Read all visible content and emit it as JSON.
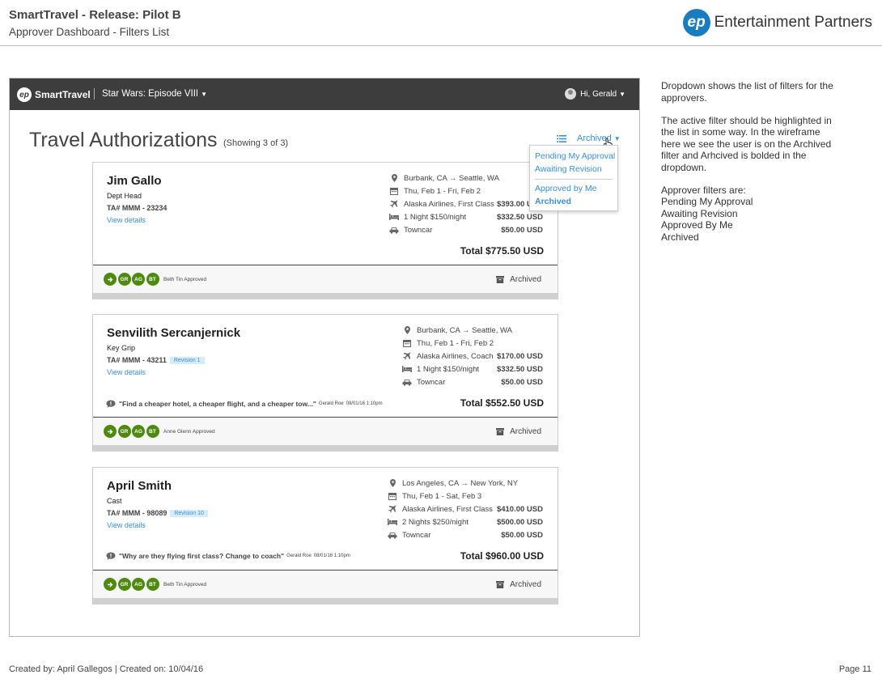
{
  "doc": {
    "title": "SmartTravel - Release: Pilot B",
    "subtitle": "Approver Dashboard - Filters List",
    "logo_mark": "ep",
    "logo_name": "Entertainment Partners",
    "footer_left": "Created by: April Gallegos | Created on: 10/04/16",
    "footer_right": "Page 11"
  },
  "app": {
    "logo_mark": "ep",
    "logo_name": "SmartTravel",
    "project": "Star Wars: Episode VIII",
    "user_greeting": "Hi, Gerald",
    "dark_color": "#3d3d3d",
    "link_color": "#3a8fd6"
  },
  "main": {
    "title": "Travel Authorizations",
    "showing": "(Showing 3 of 3)",
    "filter_label": "Archived",
    "filter_icon": "list-icon"
  },
  "dropdown": {
    "items": [
      {
        "label": "Pending My Approval",
        "active": false
      },
      {
        "label": "Awaiting Revision",
        "active": false
      },
      {
        "label": "Approved by Me",
        "active": false
      },
      {
        "label": "Archived",
        "active": true
      }
    ]
  },
  "cards": [
    {
      "name": "Jim Gallo",
      "role": "Dept Head",
      "ta": "TA# MMM - 23234",
      "revision": "",
      "view_details": "View details",
      "itinerary": [
        {
          "icon": "location-icon",
          "label": "Burbank, CA → Seattle, WA",
          "amount": ""
        },
        {
          "icon": "calendar-icon",
          "label": "Thu, Feb 1 - Fri, Feb 2",
          "amount": ""
        },
        {
          "icon": "plane-icon",
          "label": "Alaska Airlines, First Class",
          "amount": "$393.00 USD"
        },
        {
          "icon": "bed-icon",
          "label": "1 Night $150/night",
          "amount": "$332.50 USD"
        },
        {
          "icon": "car-icon",
          "label": "Towncar",
          "amount": "$50.00 USD"
        }
      ],
      "total": "Total $775.50 USD",
      "comment": null,
      "badges": [
        "GR",
        "AG",
        "BT"
      ],
      "approval": "Beth Tin Approved",
      "status": "Archived"
    },
    {
      "name": "Senvilith Sercanjernick",
      "role": "Key Grip",
      "ta": "TA# MMM - 43211",
      "revision": "Revision 1",
      "view_details": "View details",
      "itinerary": [
        {
          "icon": "location-icon",
          "label": "Burbank, CA → Seattle, WA",
          "amount": ""
        },
        {
          "icon": "calendar-icon",
          "label": "Thu, Feb 1 - Fri, Feb 2",
          "amount": ""
        },
        {
          "icon": "plane-icon",
          "label": "Alaska Airlines, Coach",
          "amount": "$170.00 USD"
        },
        {
          "icon": "bed-icon",
          "label": "1 Night $150/night",
          "amount": "$332.50 USD"
        },
        {
          "icon": "car-icon",
          "label": "Towncar",
          "amount": "$50.00 USD"
        }
      ],
      "total": "Total $552.50 USD",
      "comment": {
        "text": "\"Find a cheaper hotel, a cheaper flight, and a cheaper tow...\"",
        "author": "Gerald Roe",
        "date": "08/01/16 1:10pm"
      },
      "badges": [
        "GR",
        "AG",
        "BT"
      ],
      "approval": "Anne Glenn Approved",
      "status": "Archived"
    },
    {
      "name": "April Smith",
      "role": "Cast",
      "ta": "TA# MMM - 98089",
      "revision": "Revision 10",
      "view_details": "View details",
      "itinerary": [
        {
          "icon": "location-icon",
          "label": "Los Angeles, CA → New York, NY",
          "amount": ""
        },
        {
          "icon": "calendar-icon",
          "label": "Thu, Feb 1 - Sat, Feb 3",
          "amount": ""
        },
        {
          "icon": "plane-icon",
          "label": "Alaska Airlines, First Class",
          "amount": "$410.00 USD"
        },
        {
          "icon": "bed-icon",
          "label": "2 Nights $250/night",
          "amount": "$500.00 USD"
        },
        {
          "icon": "car-icon",
          "label": "Towncar",
          "amount": "$50.00 USD"
        }
      ],
      "total": "Total $960.00 USD",
      "comment": {
        "text": "\"Why are they flying first class? Change to coach\"",
        "author": "Gerald Roe",
        "date": "08/01/16 1:10pm"
      },
      "badges": [
        "GR",
        "AG",
        "BT"
      ],
      "approval": "Beth Tin Approved",
      "status": "Archived"
    }
  ],
  "notes": {
    "block1": [
      "Dropdown shows the list of filters for the",
      "approvers."
    ],
    "block2": [
      "The active filter should be highlighted in",
      "the list in some way. In the wireframe",
      "here we see the user is on the Archived",
      "filter and Arhcived is bolded in the",
      "dropdown."
    ],
    "block3": [
      "Approver filters are:",
      "Pending My Approval",
      "Awaiting Revision",
      "Approved By Me",
      "Archived"
    ]
  }
}
